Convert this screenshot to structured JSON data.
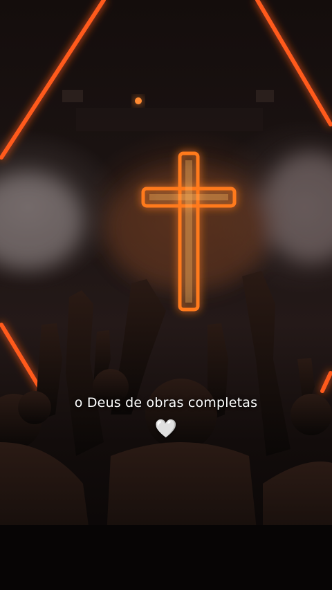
{
  "caption": {
    "text": "o Deus de obras completas",
    "heart": "🤍"
  },
  "colors": {
    "neon_orange": "#ff7a1f",
    "neon_core": "#ffd27a",
    "background": "#0c0808",
    "text": "#ffffff"
  }
}
